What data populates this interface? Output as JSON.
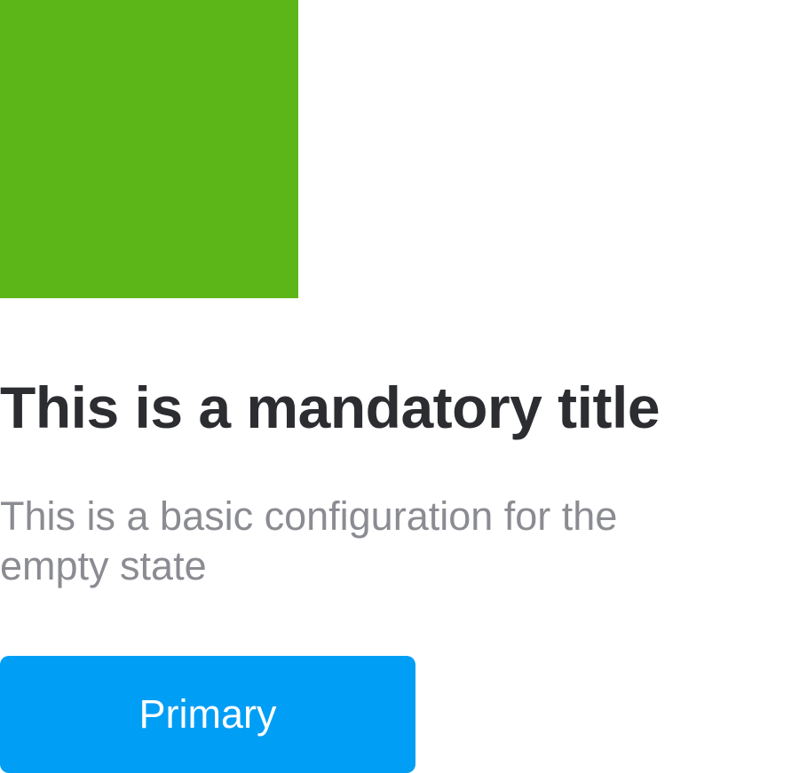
{
  "empty_state": {
    "illustration_color": "#5db617",
    "title": "This is a mandatory title",
    "description": "This is a basic configuration for the empty state",
    "primary_button": {
      "label": "Primary",
      "color": "#009ef5"
    }
  }
}
